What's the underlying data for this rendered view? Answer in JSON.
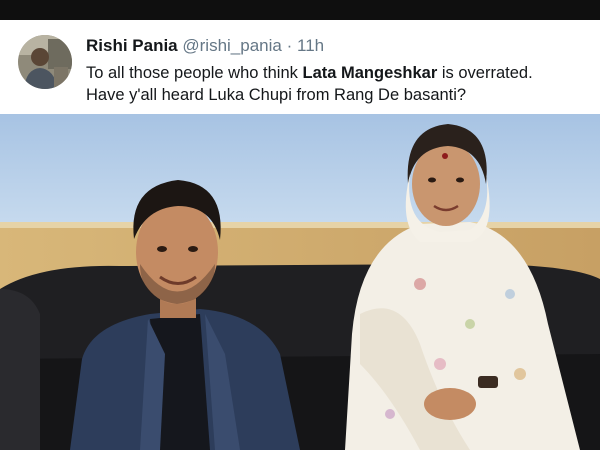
{
  "tweet": {
    "display_name": "Rishi Pania",
    "handle": "@rishi_pania",
    "separator": "·",
    "timestamp": "11h",
    "text_part1": "To all those people who think ",
    "text_bold": "Lata Mangeshkar",
    "text_part2": " is overrated.",
    "text_line2": "Have y'all heard Luka Chupi from Rang De basanti?"
  },
  "colors": {
    "top_bar": "#0f0f0f",
    "text_primary": "#14171a",
    "text_secondary": "#657786"
  },
  "icons": {
    "avatar": "user-avatar"
  }
}
